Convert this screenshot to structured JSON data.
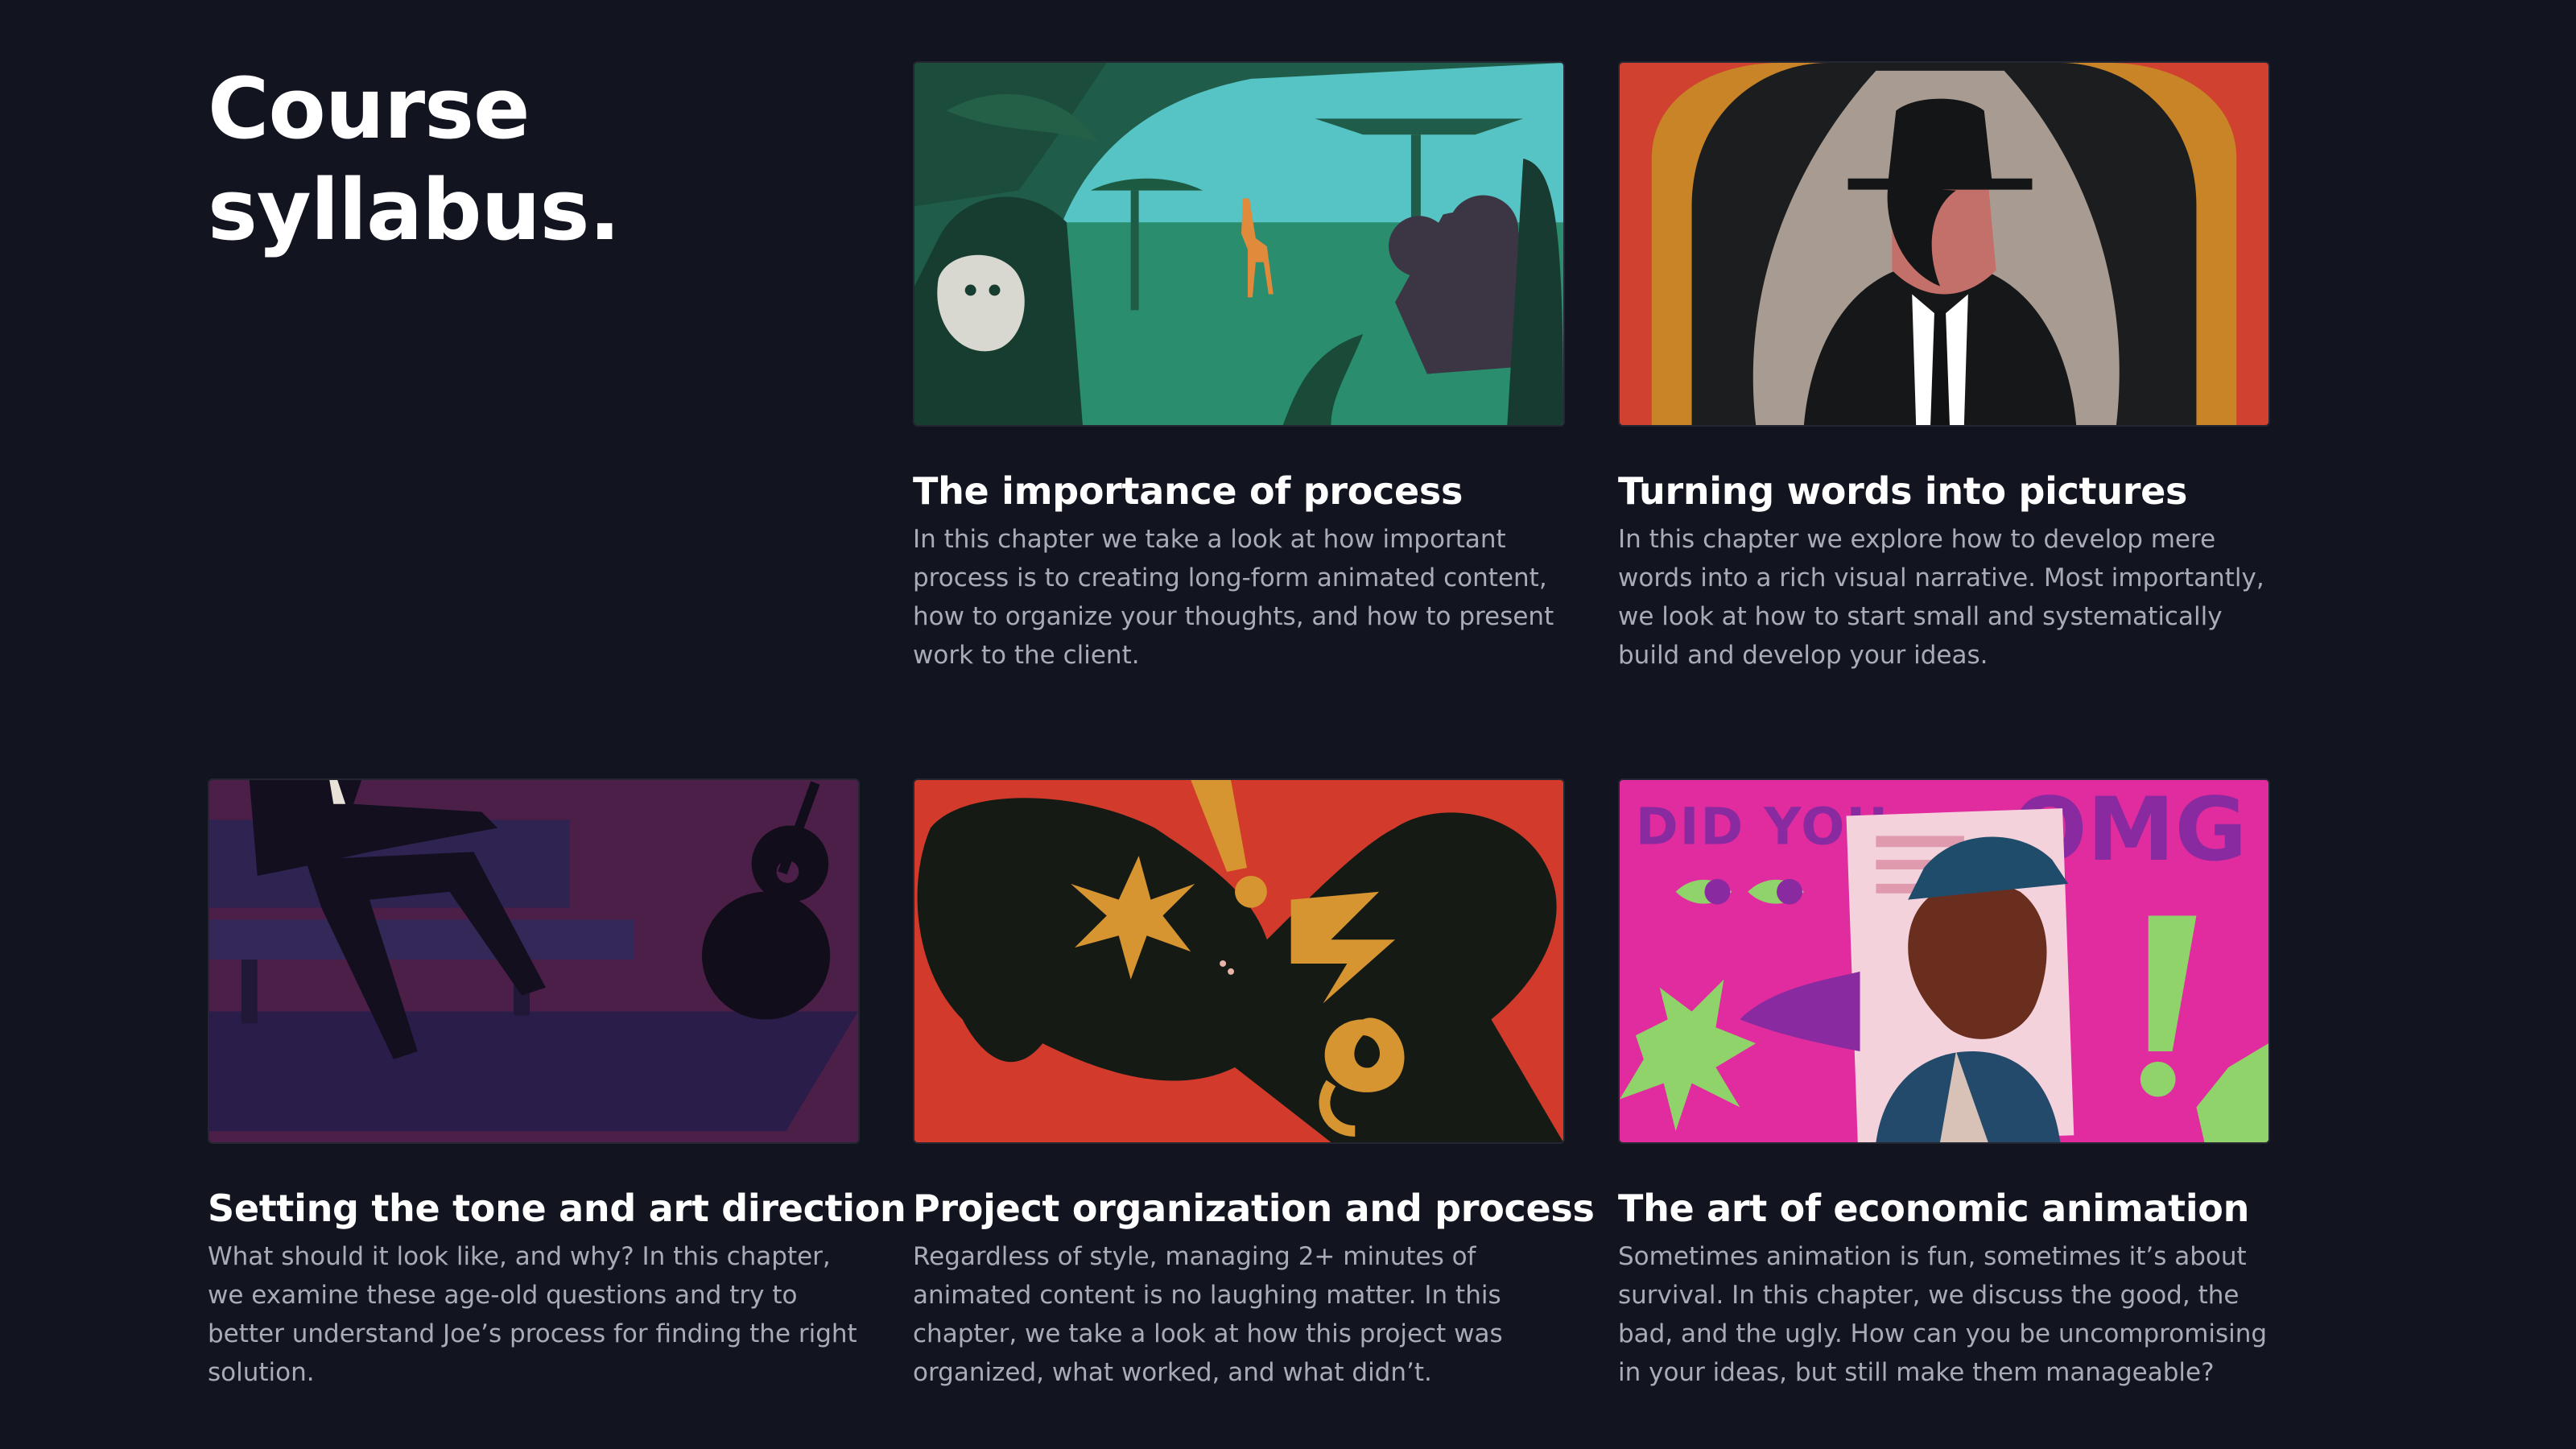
{
  "page": {
    "title_line1": "Course",
    "title_line2": "syllabus."
  },
  "chapters": [
    {
      "title": "The importance of process",
      "description": "In this chapter we take a look at how important process is to creating long-form animated content, how to organize your thoughts, and how to present work to the client.",
      "thumbnail": "jungle-gorilla-giraffe-camera-illustration"
    },
    {
      "title": "Turning words into pictures",
      "description": "In this chapter we explore how to develop mere words into a rich visual narrative. Most importantly, we look at how to start small and systematically build and develop your ideas.",
      "thumbnail": "man-in-fedora-portrait-illustration"
    },
    {
      "title": "Setting the tone and art direction",
      "description": "What should it look like, and why? In this chapter, we examine these age-old questions and try to better understand Joe’s process for finding the right solution.",
      "thumbnail": "man-on-bench-with-guitar-illustration"
    },
    {
      "title": "Project organization and process",
      "description": "Regardless of style, managing 2+ minutes of animated content is no laughing matter. In this chapter, we take a look at how this project was organized, what worked, and what didn’t.",
      "thumbnail": "shouting-silhouette-exclamation-illustration"
    },
    {
      "title": "The art of economic animation",
      "description": "Sometimes animation is fun, sometimes it’s about survival. In this chapter, we discuss the good, the bad, and the ugly. How can you be uncompromising in your ideas, but still make them manageable?",
      "thumbnail": "magazine-woman-did-you-omg-illustration",
      "thumbnail_text": {
        "left": "DID YOU",
        "right": "OMG"
      }
    }
  ],
  "colors": {
    "background": "#121420",
    "title": "#ffffff",
    "description": "#a9abb5"
  }
}
